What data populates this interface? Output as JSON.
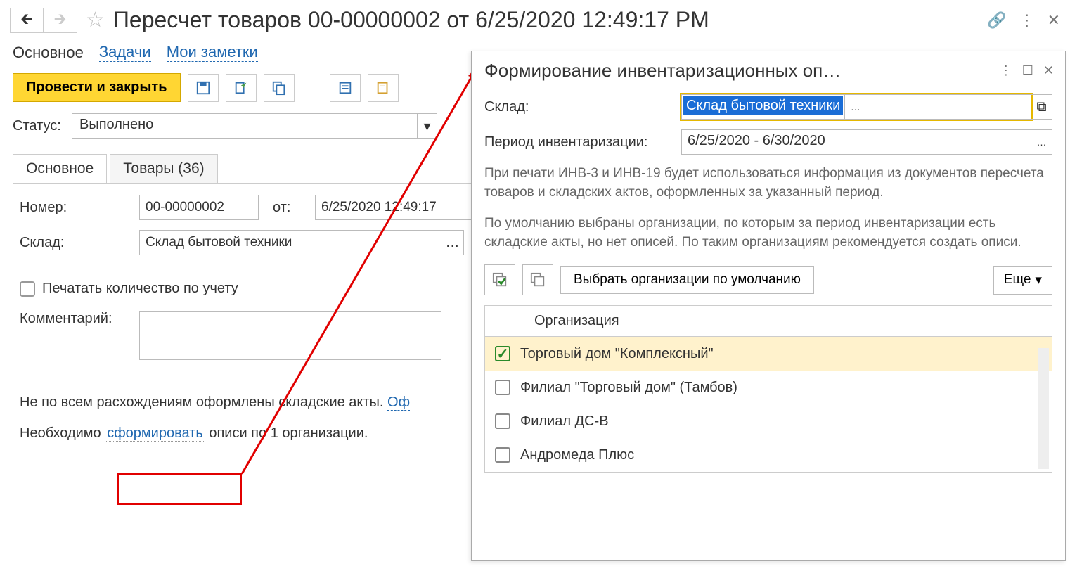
{
  "header": {
    "title": "Пересчет товаров 00-00000002 от 6/25/2020 12:49:17 PM"
  },
  "nav_tabs": {
    "main": "Основное",
    "tasks": "Задачи",
    "notes": "Мои заметки"
  },
  "toolbar": {
    "submit": "Провести и закрыть"
  },
  "status": {
    "label": "Статус:",
    "value": "Выполнено"
  },
  "doc_tabs": {
    "main": "Основное",
    "goods": "Товары (36)"
  },
  "form": {
    "number_label": "Номер:",
    "number_value": "00-00000002",
    "from_label": "от:",
    "from_value": "6/25/2020 12:49:17",
    "warehouse_label": "Склад:",
    "warehouse_value": "Склад бытовой техники",
    "print_qty": "Печатать количество по учету",
    "comment_label": "Комментарий:"
  },
  "info": {
    "line1a": "Не по всем расхождениям оформлены складские акты. ",
    "line1b": "Оф",
    "line2a": "Необходимо ",
    "line2b": "сформировать",
    "line2c": " описи по 1 организации."
  },
  "dialog": {
    "title": "Формирование инвентаризационных оп…",
    "warehouse_label": "Склад:",
    "warehouse_value": "Склад бытовой техники",
    "period_label": "Период инвентаризации:",
    "period_value": "6/25/2020 - 6/30/2020",
    "info1": "При печати ИНВ-3 и ИНВ-19 будет использоваться информация из документов пересчета товаров и складских актов, оформленных за указанный период.",
    "info2": "По умолчанию выбраны организации, по которым за период инвентаризации есть складские акты, но нет описей. По таким организациям рекомендуется создать описи.",
    "default_btn": "Выбрать организации по умолчанию",
    "more_btn": "Еще",
    "col_org": "Организация",
    "orgs": [
      {
        "name": "Торговый дом \"Комплексный\"",
        "checked": true
      },
      {
        "name": "Филиал \"Торговый дом\" (Тамбов)",
        "checked": false
      },
      {
        "name": "Филиал ДС-В",
        "checked": false
      },
      {
        "name": "Андромеда Плюс",
        "checked": false
      }
    ]
  }
}
